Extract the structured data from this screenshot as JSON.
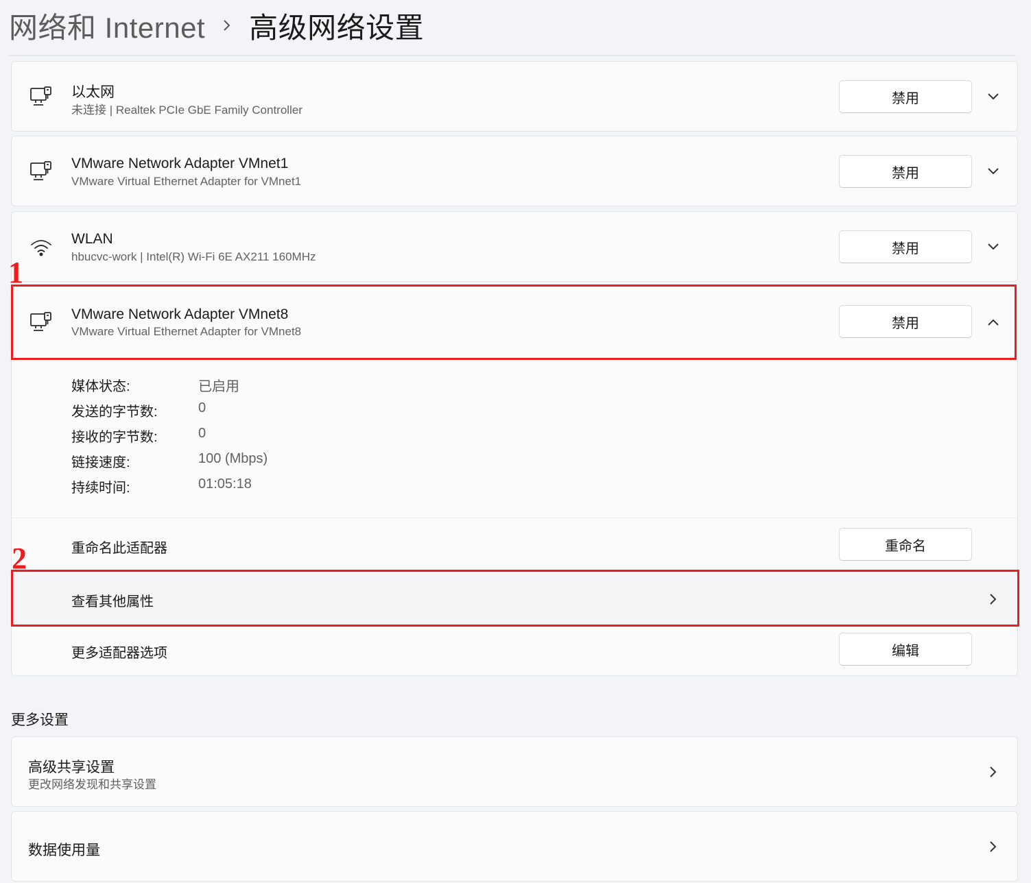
{
  "breadcrumb": {
    "parent": "网络和 Internet",
    "separator_icon": "chevron-right-icon",
    "current": "高级网络设置"
  },
  "adapters": [
    {
      "title": "以太网",
      "subtitle": "未连接 | Realtek PCIe GbE Family Controller",
      "icon": "ethernet-icon",
      "button": "禁用",
      "chevron": "chevron-down-icon"
    },
    {
      "title": "VMware Network Adapter VMnet1",
      "subtitle": "VMware Virtual Ethernet Adapter for VMnet1",
      "icon": "ethernet-icon",
      "button": "禁用",
      "chevron": "chevron-down-icon"
    },
    {
      "title": "WLAN",
      "subtitle": "hbucvc-work | Intel(R) Wi-Fi 6E AX211 160MHz",
      "icon": "wifi-icon",
      "button": "禁用",
      "chevron": "chevron-down-icon"
    }
  ],
  "expanded_adapter": {
    "title": "VMware Network Adapter VMnet8",
    "subtitle": "VMware Virtual Ethernet Adapter for VMnet8",
    "icon": "ethernet-icon",
    "button": "禁用",
    "chevron": "chevron-up-icon",
    "properties": [
      {
        "key": "媒体状态:",
        "value": "已启用"
      },
      {
        "key": "发送的字节数:",
        "value": "0"
      },
      {
        "key": "接收的字节数:",
        "value": "0"
      },
      {
        "key": "链接速度:",
        "value": "100 (Mbps)"
      },
      {
        "key": "持续时间:",
        "value": "01:05:18"
      }
    ],
    "rename": {
      "label": "重命名此适配器",
      "button": "重命名"
    },
    "view_properties": {
      "label": "查看其他属性"
    },
    "more_options": {
      "label": "更多适配器选项",
      "button": "编辑"
    }
  },
  "more_settings": {
    "heading": "更多设置",
    "items": [
      {
        "title": "高级共享设置",
        "subtitle": "更改网络发现和共享设置"
      },
      {
        "title": "数据使用量"
      }
    ]
  },
  "annotations": {
    "marker_1": "1",
    "marker_2": "2",
    "color": "#ee1c1c"
  }
}
